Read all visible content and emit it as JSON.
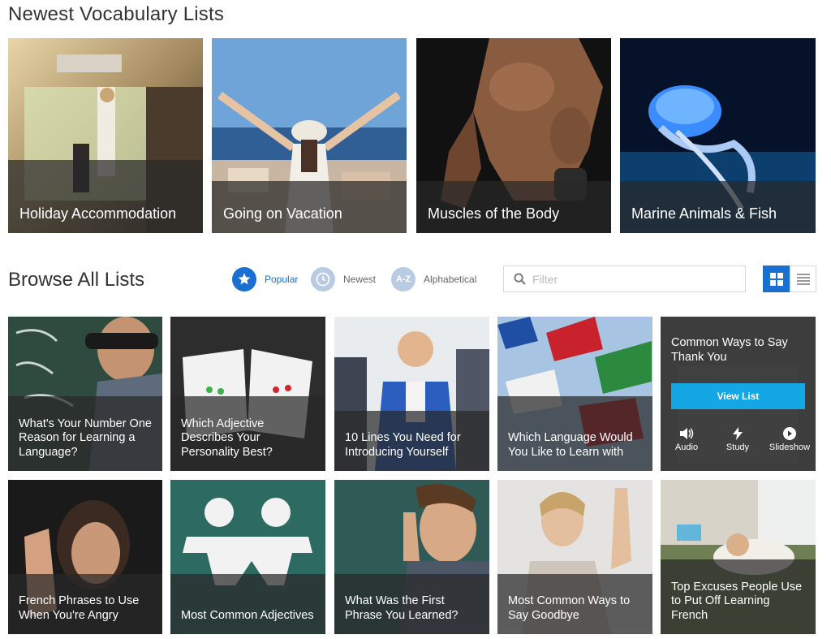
{
  "newest": {
    "title": "Newest Vocabulary Lists",
    "cards": [
      {
        "label": "Holiday Accommodation"
      },
      {
        "label": "Going on Vacation"
      },
      {
        "label": "Muscles of the Body"
      },
      {
        "label": "Marine Animals & Fish"
      }
    ]
  },
  "browse": {
    "title": "Browse All Lists",
    "sort_options": [
      {
        "label": "Popular",
        "icon": "star-icon",
        "active": true
      },
      {
        "label": "Newest",
        "icon": "clock-icon",
        "active": false
      },
      {
        "label": "Alphabetical",
        "icon": "a-z-icon",
        "icon_text": "A-Z",
        "active": false
      }
    ],
    "filter": {
      "placeholder": "Filter",
      "value": ""
    },
    "view_modes": [
      {
        "name": "grid-view",
        "icon": "grid-icon",
        "active": true
      },
      {
        "name": "list-view",
        "icon": "list-icon",
        "active": false
      }
    ],
    "lists": [
      {
        "label": "What's Your Number One Reason for Learning a Language?"
      },
      {
        "label": "Which Adjective Describes Your Personality Best?"
      },
      {
        "label": "10 Lines You Need for Introducing Yourself"
      },
      {
        "label": "Which Language Would You Like to Learn with"
      },
      {
        "label": "Common Ways to Say Thank You",
        "hovered": true
      },
      {
        "label": "French Phrases to Use When You're Angry"
      },
      {
        "label": "Most Common Adjectives"
      },
      {
        "label": "What Was the First Phrase You Learned?"
      },
      {
        "label": "Most Common Ways to Say Goodbye"
      },
      {
        "label": "Top Excuses People Use to Put Off Learning French"
      }
    ],
    "hover_actions": {
      "view_list": "View List",
      "audio": "Audio",
      "study": "Study",
      "slideshow": "Slideshow"
    }
  },
  "colors": {
    "accent": "#1a6fd0",
    "view_list_button": "#15a6e6",
    "inactive_icon": "#b8cbe3"
  }
}
